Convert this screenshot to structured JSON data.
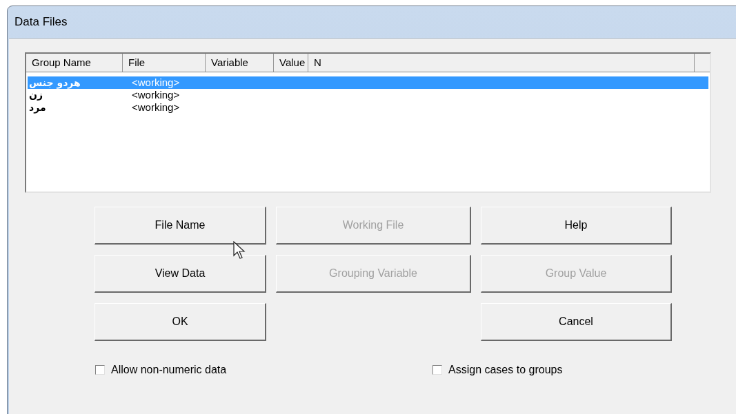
{
  "window": {
    "title": "Data Files"
  },
  "table": {
    "columns": [
      "Group Name",
      "File",
      "Variable",
      "Value",
      "N"
    ],
    "rows": [
      {
        "group_name": "هردو جنس",
        "file": "<working>",
        "selected": true
      },
      {
        "group_name": "زن",
        "file": "<working>",
        "selected": false
      },
      {
        "group_name": "مرد",
        "file": "<working>",
        "selected": false
      }
    ]
  },
  "buttons": [
    {
      "label": "File Name",
      "disabled": false
    },
    {
      "label": "Working File",
      "disabled": true
    },
    {
      "label": "Help",
      "disabled": false
    },
    {
      "label": "View Data",
      "disabled": false
    },
    {
      "label": "Grouping Variable",
      "disabled": true
    },
    {
      "label": "Group Value",
      "disabled": true
    },
    {
      "label": "OK",
      "disabled": false
    },
    {
      "kind": "spacer"
    },
    {
      "label": "Cancel",
      "disabled": false
    }
  ],
  "checkboxes": [
    {
      "label": "Allow non-numeric data",
      "checked": false
    },
    {
      "label": "Assign cases to groups",
      "checked": false
    }
  ]
}
